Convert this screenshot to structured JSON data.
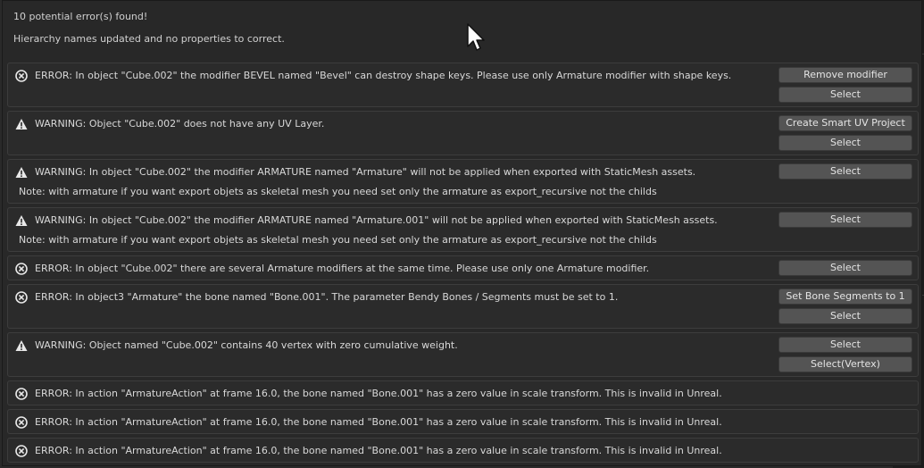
{
  "header": {
    "summary": "10 potential error(s) found!",
    "hierarchy_note": "Hierarchy names updated and no properties to correct."
  },
  "icons": {
    "error": "error-circle-x-icon",
    "warning": "warning-triangle-icon",
    "cursor": "mouse-cursor-icon"
  },
  "colors": {
    "button": "#545454",
    "panel": "#2b2b2b",
    "background": "#282828"
  },
  "reports": [
    {
      "type": "error",
      "message": "ERROR: In object \"Cube.002\" the modifier BEVEL named \"Bevel\" can destroy shape keys. Please use only Armature modifier with shape keys.",
      "buttons": [
        "Remove modifier",
        "Select"
      ]
    },
    {
      "type": "warning",
      "message": "WARNING: Object \"Cube.002\" does not have any UV Layer.",
      "buttons": [
        "Create Smart UV Project",
        "Select"
      ]
    },
    {
      "type": "warning",
      "message": "WARNING: In object \"Cube.002\" the modifier ARMATURE named \"Armature\" will not be applied when exported with StaticMesh assets.",
      "note": "Note: with armature if you want export objets as skeletal mesh you need set only the armature as export_recursive not the childs",
      "buttons": [
        "Select"
      ]
    },
    {
      "type": "warning",
      "message": "WARNING: In object \"Cube.002\" the modifier ARMATURE named \"Armature.001\" will not be applied when exported with StaticMesh assets.",
      "note": "Note: with armature if you want export objets as skeletal mesh you need set only the armature as export_recursive not the childs",
      "buttons": [
        "Select"
      ]
    },
    {
      "type": "error",
      "message": "ERROR: In object \"Cube.002\" there are several Armature modifiers at the same time. Please use only one Armature modifier.",
      "buttons": [
        "Select"
      ]
    },
    {
      "type": "error",
      "message": "ERROR: In object3 \"Armature\" the bone named \"Bone.001\". The parameter Bendy Bones / Segments must be set to 1.",
      "buttons": [
        "Set Bone Segments to 1",
        "Select"
      ]
    },
    {
      "type": "warning",
      "message": "WARNING: Object named \"Cube.002\" contains 40 vertex with zero cumulative weight.",
      "buttons": [
        "Select",
        "Select(Vertex)"
      ]
    },
    {
      "type": "error",
      "message": "ERROR: In action \"ArmatureAction\" at frame 16.0, the bone named \"Bone.001\" has a zero value in scale transform. This is invalid in Unreal.",
      "buttons": []
    },
    {
      "type": "error",
      "message": "ERROR: In action \"ArmatureAction\" at frame 16.0, the bone named \"Bone.001\" has a zero value in scale transform. This is invalid in Unreal.",
      "buttons": []
    },
    {
      "type": "error",
      "message": "ERROR: In action \"ArmatureAction\" at frame 16.0, the bone named \"Bone.001\" has a zero value in scale transform. This is invalid in Unreal.",
      "buttons": []
    }
  ]
}
